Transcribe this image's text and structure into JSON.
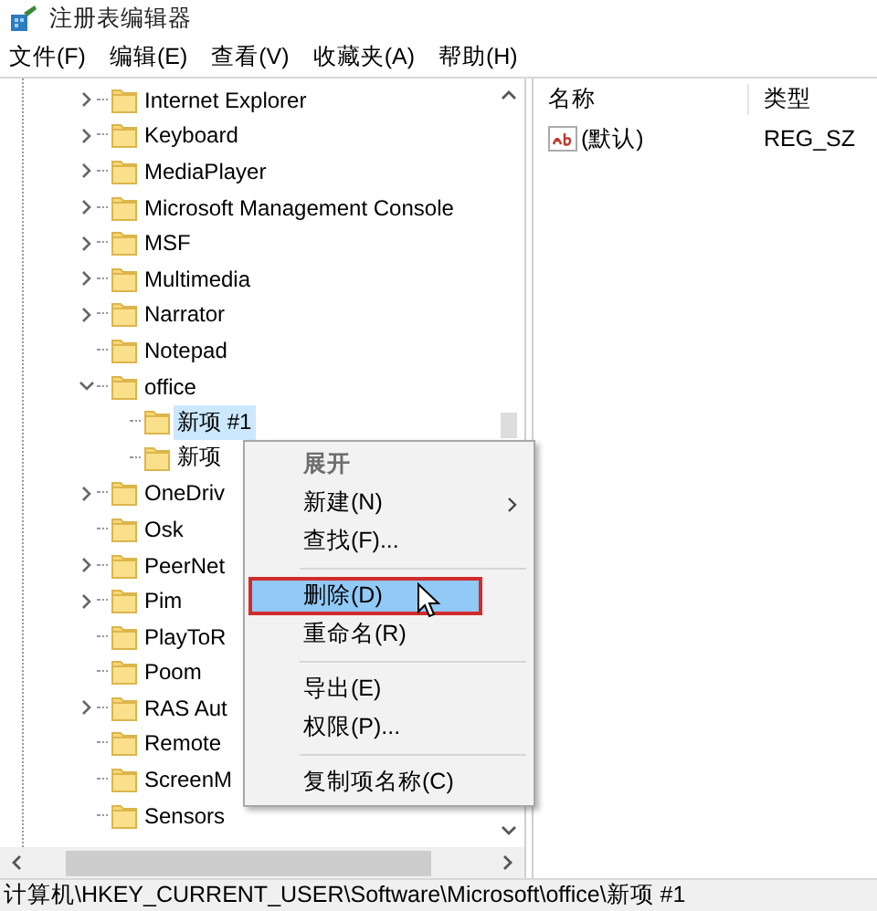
{
  "window": {
    "title": "注册表编辑器"
  },
  "menu_bar": [
    {
      "label": "文件(F)"
    },
    {
      "label": "编辑(E)"
    },
    {
      "label": "查看(V)"
    },
    {
      "label": "收藏夹(A)"
    },
    {
      "label": "帮助(H)"
    }
  ],
  "tree": [
    {
      "label": "Internet Explorer",
      "expandable": true,
      "expanded": false,
      "selected": false
    },
    {
      "label": "Keyboard",
      "expandable": true,
      "expanded": false,
      "selected": false
    },
    {
      "label": "MediaPlayer",
      "expandable": true,
      "expanded": false,
      "selected": false
    },
    {
      "label": "Microsoft Management Console",
      "expandable": true,
      "expanded": false,
      "selected": false
    },
    {
      "label": "MSF",
      "expandable": true,
      "expanded": false,
      "selected": false
    },
    {
      "label": "Multimedia",
      "expandable": true,
      "expanded": false,
      "selected": false
    },
    {
      "label": "Narrator",
      "expandable": true,
      "expanded": false,
      "selected": false
    },
    {
      "label": "Notepad",
      "expandable": false,
      "selected": false
    },
    {
      "label": "office",
      "expandable": true,
      "expanded": true,
      "selected": false,
      "children": [
        {
          "label": "新项 #1",
          "expandable": false,
          "selected": true
        },
        {
          "label": "新项",
          "expandable": false,
          "selected": false
        }
      ]
    },
    {
      "label": "OneDriv",
      "expandable": true,
      "expanded": false,
      "selected": false
    },
    {
      "label": "Osk",
      "expandable": false,
      "selected": false
    },
    {
      "label": "PeerNet",
      "expandable": true,
      "expanded": false,
      "selected": false
    },
    {
      "label": "Pim",
      "expandable": true,
      "expanded": false,
      "selected": false
    },
    {
      "label": "PlayToR",
      "expandable": false,
      "selected": false
    },
    {
      "label": "Poom",
      "expandable": false,
      "selected": false
    },
    {
      "label": "RAS Aut",
      "expandable": true,
      "expanded": false,
      "selected": false
    },
    {
      "label": "Remote",
      "expandable": false,
      "selected": false
    },
    {
      "label": "ScreenM",
      "expandable": false,
      "selected": false
    },
    {
      "label": "Sensors",
      "expandable": false,
      "selected": false
    }
  ],
  "values_table": {
    "columns": [
      "名称",
      "类型"
    ],
    "rows": [
      {
        "name": "(默认)",
        "type": "REG_SZ"
      }
    ]
  },
  "context_menu": [
    {
      "kind": "item",
      "label": "展开",
      "disabled": true,
      "selected": false,
      "submenu": false,
      "marked": false
    },
    {
      "kind": "item",
      "label": "新建(N)",
      "disabled": false,
      "selected": false,
      "submenu": true,
      "marked": false
    },
    {
      "kind": "item",
      "label": "查找(F)...",
      "disabled": false,
      "selected": false,
      "submenu": false,
      "marked": false
    },
    {
      "kind": "separator"
    },
    {
      "kind": "item",
      "label": "删除(D)",
      "disabled": false,
      "selected": true,
      "submenu": false,
      "marked": true
    },
    {
      "kind": "item",
      "label": "重命名(R)",
      "disabled": false,
      "selected": false,
      "submenu": false,
      "marked": false
    },
    {
      "kind": "separator"
    },
    {
      "kind": "item",
      "label": "导出(E)",
      "disabled": false,
      "selected": false,
      "submenu": false,
      "marked": false
    },
    {
      "kind": "item",
      "label": "权限(P)...",
      "disabled": false,
      "selected": false,
      "submenu": false,
      "marked": false
    },
    {
      "kind": "separator"
    },
    {
      "kind": "item",
      "label": "复制项名称(C)",
      "disabled": false,
      "selected": false,
      "submenu": false,
      "marked": false
    }
  ],
  "status_bar": "计算机\\HKEY_CURRENT_USER\\Software\\Microsoft\\office\\新项 #1"
}
